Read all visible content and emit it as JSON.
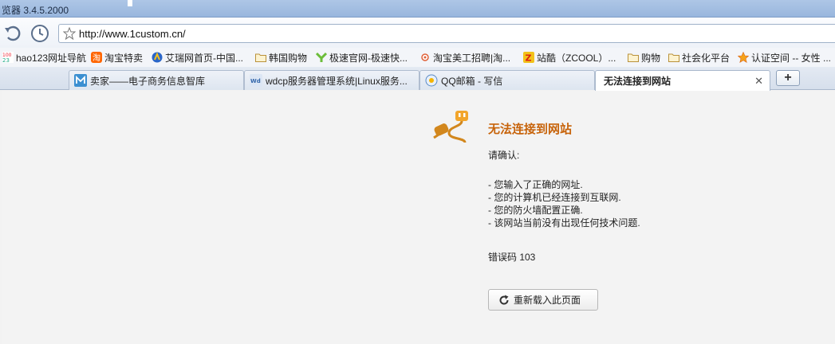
{
  "window": {
    "title": "览器 3.4.5.2000"
  },
  "toolbar": {
    "url": "http://www.1custom.cn/"
  },
  "bookmarks": [
    {
      "label": "hao123网址导航",
      "icon": "hao123-icon"
    },
    {
      "label": "淘宝特卖",
      "icon": "taobao-icon"
    },
    {
      "label": "艾瑞网首页-中国...",
      "icon": "iresearch-icon"
    },
    {
      "label": "韩国购物",
      "icon": "folder-icon"
    },
    {
      "label": "极速官网-极速快...",
      "icon": "jisu-icon"
    },
    {
      "label": "淘宝美工招聘|淘...",
      "icon": "page-icon"
    },
    {
      "label": "站酷（ZCOOL）...",
      "icon": "zcool-icon"
    },
    {
      "label": "购物",
      "icon": "folder-icon"
    },
    {
      "label": "社会化平台",
      "icon": "folder-icon"
    },
    {
      "label": "认证空间 -- 女性 ...",
      "icon": "star-icon"
    }
  ],
  "tabs": [
    {
      "label": "卖家——电子商务信息智库",
      "icon": "maijia-icon"
    },
    {
      "label": "wdcp服务器管理系统|Linux服务...",
      "icon": "wdcp-icon"
    },
    {
      "label": "QQ邮箱 - 写信",
      "icon": "qqmail-icon"
    },
    {
      "label": "无法连接到网站",
      "icon": "",
      "active": true
    }
  ],
  "error": {
    "title": "无法连接到网站",
    "confirm_label": "请确认:",
    "reasons": [
      "- 您输入了正确的网址.",
      "- 您的计算机已经连接到互联网.",
      "- 您的防火墙配置正确.",
      "- 该网站当前没有出现任何技术问题."
    ],
    "code": "错误码 103",
    "reload_label": "重新载入此页面"
  },
  "colors": {
    "accent": "#c7630a",
    "titlebar": "#aec6e6"
  }
}
